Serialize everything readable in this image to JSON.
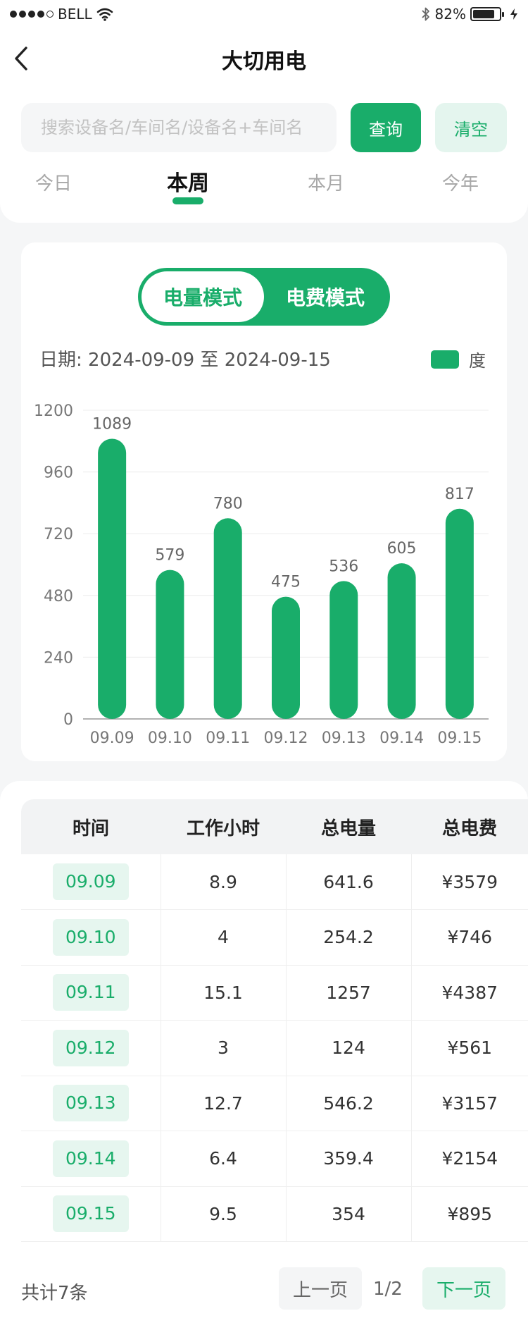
{
  "status_bar": {
    "carrier": "BELL",
    "battery_percent": "82%",
    "battery_level": 0.82,
    "icons": [
      "signal-dots-icon",
      "wifi-icon",
      "bluetooth-icon",
      "battery-icon",
      "charging-bolt-icon"
    ]
  },
  "nav": {
    "title": "大切用电",
    "back_icon": "chevron-left-icon"
  },
  "search": {
    "placeholder": "搜索设备名/车间名/设备名+车间名",
    "value": "",
    "query_label": "查询",
    "clear_label": "清空"
  },
  "period_tabs": {
    "items": [
      {
        "label": "今日",
        "active": false
      },
      {
        "label": "本周",
        "active": true
      },
      {
        "label": "本月",
        "active": false
      },
      {
        "label": "今年",
        "active": false
      }
    ]
  },
  "mode_toggle": {
    "options": [
      {
        "label": "电量模式",
        "active": true
      },
      {
        "label": "电费模式",
        "active": false
      }
    ]
  },
  "date_range": {
    "label": "日期:",
    "start": "2024-09-09",
    "separator": "至",
    "end": "2024-09-15"
  },
  "chart_data": {
    "type": "bar",
    "categories": [
      "09.09",
      "09.10",
      "09.11",
      "09.12",
      "09.13",
      "09.14",
      "09.15"
    ],
    "values": [
      1089,
      579,
      780,
      475,
      536,
      605,
      817
    ],
    "series_name": "度",
    "ylim": [
      0,
      1200
    ],
    "yticks": [
      0,
      240,
      480,
      720,
      960,
      1200
    ],
    "grid": true,
    "legend": "top-right",
    "color": "#19ad6a"
  },
  "table": {
    "headers": [
      "时间",
      "工作小时",
      "总电量",
      "总电费"
    ],
    "rows": [
      {
        "date": "09.09",
        "hours": "8.9",
        "energy": "641.6",
        "cost": "¥3579"
      },
      {
        "date": "09.10",
        "hours": "4",
        "energy": "254.2",
        "cost": "¥746"
      },
      {
        "date": "09.11",
        "hours": "15.1",
        "energy": "1257",
        "cost": "¥4387"
      },
      {
        "date": "09.12",
        "hours": "3",
        "energy": "124",
        "cost": "¥561"
      },
      {
        "date": "09.13",
        "hours": "12.7",
        "energy": "546.2",
        "cost": "¥3157"
      },
      {
        "date": "09.14",
        "hours": "6.4",
        "energy": "359.4",
        "cost": "¥2154"
      },
      {
        "date": "09.15",
        "hours": "9.5",
        "energy": "354",
        "cost": "¥895"
      }
    ]
  },
  "pager": {
    "total": "共计7条",
    "prev_label": "上一页",
    "page_indicator": "1/2",
    "next_label": "下一页"
  },
  "colors": {
    "accent": "#19ad6a",
    "accent_light": "#e6f6ef",
    "background": "#f5f6f7"
  }
}
